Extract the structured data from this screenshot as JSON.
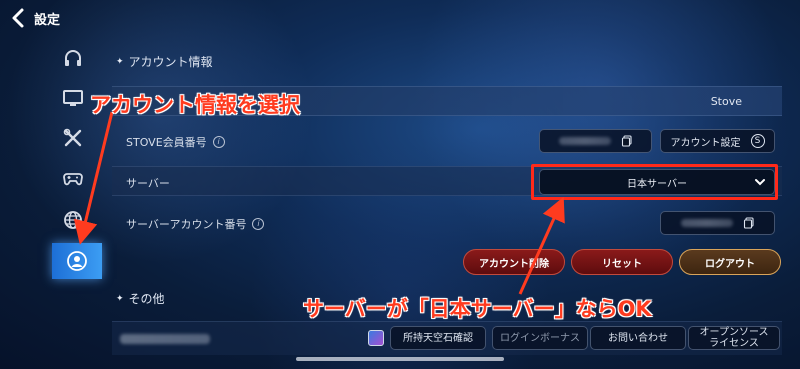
{
  "header": {
    "back_icon": "chevron-left-icon",
    "title": "設定"
  },
  "sidebar": {
    "items": [
      {
        "icon": "headphones-icon",
        "active": false
      },
      {
        "icon": "monitor-icon",
        "active": false
      },
      {
        "icon": "tools-icon",
        "active": false
      },
      {
        "icon": "gamepad-icon",
        "active": false
      },
      {
        "icon": "globe-icon",
        "active": false
      },
      {
        "icon": "user-icon",
        "active": true
      }
    ]
  },
  "account": {
    "section_title": "アカウント情報",
    "platform_value": "Stove",
    "member_label": "STOVE会員番号",
    "account_settings_label": "アカウント設定",
    "server_label": "サーバー",
    "server_value": "日本サーバー",
    "server_account_label": "サーバーアカウント番号",
    "delete_label": "アカウント削除",
    "reset_label": "リセット",
    "logout_label": "ログアウト"
  },
  "other": {
    "section_title": "その他",
    "crystal_label": "所持天空石確認",
    "login_bonus_label": "ログインボーナス",
    "contact_label": "お問い合わせ",
    "license_label_1": "オープンソース",
    "license_label_2": "ライセンス"
  },
  "annotations": {
    "select_account": "アカウント情報を選択",
    "server_ok": "サーバーが「日本サーバー」ならOK"
  },
  "colors": {
    "annotation_red": "#ff3b1f",
    "accent_blue": "#3c9df3",
    "button_red": "#8a1a1a",
    "button_gold": "#d9a45a"
  }
}
